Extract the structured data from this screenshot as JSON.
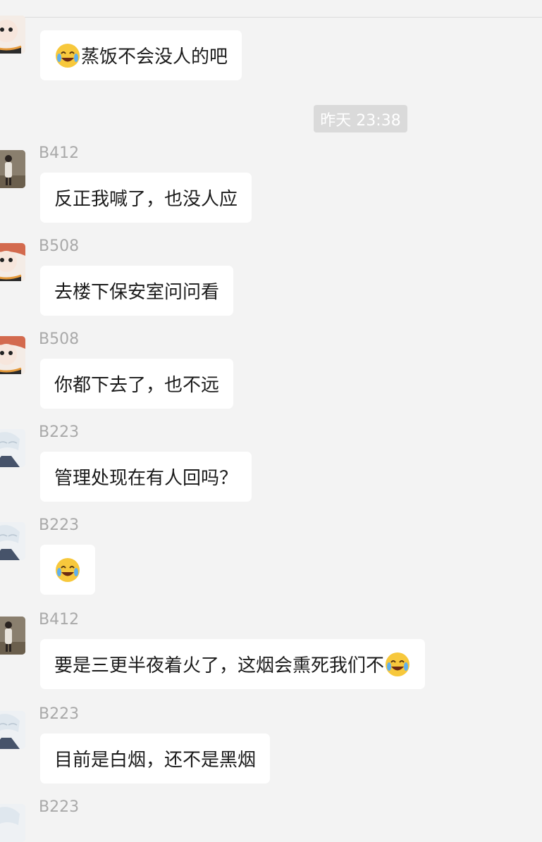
{
  "timestamp": "昨天 23:38",
  "messages": [
    {
      "name": "",
      "avatar": "B508",
      "text": "蒸饭不会没人的吧",
      "emoji_before": true,
      "emoji_after": false
    },
    {
      "name": "B412",
      "avatar": "B412",
      "text": "反正我喊了，也没人应",
      "emoji_before": false,
      "emoji_after": false
    },
    {
      "name": "B508",
      "avatar": "B508",
      "text": "去楼下保安室问问看",
      "emoji_before": false,
      "emoji_after": false
    },
    {
      "name": "B508",
      "avatar": "B508",
      "text": "你都下去了，也不远",
      "emoji_before": false,
      "emoji_after": false
    },
    {
      "name": "B223",
      "avatar": "B223",
      "text": "管理处现在有人回吗？",
      "emoji_before": false,
      "emoji_after": false
    },
    {
      "name": "B223",
      "avatar": "B223",
      "text": "",
      "emoji_before": true,
      "emoji_after": false
    },
    {
      "name": "B412",
      "avatar": "B412",
      "text": "要是三更半夜着火了，这烟会熏死我们不",
      "emoji_before": false,
      "emoji_after": true
    },
    {
      "name": "B223",
      "avatar": "B223",
      "text": "目前是白烟，还不是黑烟",
      "emoji_before": false,
      "emoji_after": false
    },
    {
      "name": "B223",
      "avatar": "B223",
      "text": "",
      "emoji_before": false,
      "emoji_after": false
    }
  ],
  "emoji": {
    "name": "tears-of-joy-emoji",
    "color": "#f7c83c"
  },
  "colors": {
    "background": "#f3f3f3",
    "bubble": "#ffffff",
    "name": "#a9a9a9",
    "timestamp_bg": "#dadada"
  }
}
